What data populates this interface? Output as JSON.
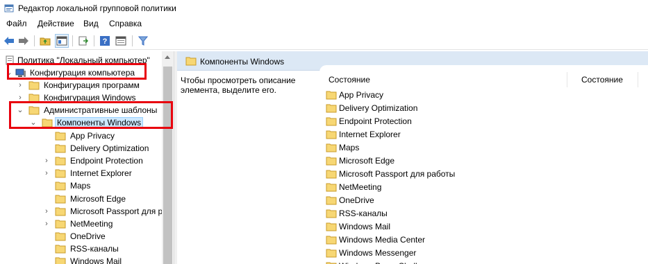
{
  "window": {
    "title": "Редактор локальной групповой политики"
  },
  "menu": [
    "Файл",
    "Действие",
    "Вид",
    "Справка"
  ],
  "toolbar": {
    "buttons": [
      "back-arrow-icon",
      "forward-arrow-icon",
      "up-folder-icon",
      "show-hide-tree-icon",
      "export-list-icon",
      "help-icon",
      "properties-icon",
      "filter-icon"
    ]
  },
  "tree": {
    "root": "Политика \"Локальный компьютер\"",
    "computer_config": "Конфигурация компьютера",
    "software_config": "Конфигурация программ",
    "windows_config": "Конфигурация Windows",
    "admin_templates": "Административные шаблоны",
    "windows_components": "Компоненты Windows",
    "children": [
      {
        "label": "App Privacy",
        "expandable": false
      },
      {
        "label": "Delivery Optimization",
        "expandable": false
      },
      {
        "label": "Endpoint Protection",
        "expandable": true
      },
      {
        "label": "Internet Explorer",
        "expandable": true
      },
      {
        "label": "Maps",
        "expandable": false
      },
      {
        "label": "Microsoft Edge",
        "expandable": false
      },
      {
        "label": "Microsoft Passport для р",
        "expandable": true
      },
      {
        "label": "NetMeeting",
        "expandable": true
      },
      {
        "label": "OneDrive",
        "expandable": false
      },
      {
        "label": "RSS-каналы",
        "expandable": false
      },
      {
        "label": "Windows Mail",
        "expandable": false
      }
    ]
  },
  "right": {
    "header": "Компоненты Windows",
    "description": "Чтобы просмотреть описание элемента, выделите его.",
    "columns": [
      "Состояние",
      "Состояние"
    ],
    "items": [
      "App Privacy",
      "Delivery Optimization",
      "Endpoint Protection",
      "Internet Explorer",
      "Maps",
      "Microsoft Edge",
      "Microsoft Passport для работы",
      "NetMeeting",
      "OneDrive",
      "RSS-каналы",
      "Windows Mail",
      "Windows Media Center",
      "Windows Messenger",
      "Windows PowerShell"
    ]
  },
  "colors": {
    "highlight_box": "#e8000d",
    "header_bg": "#dce8f5",
    "selection": "#cce8ff",
    "folder": "#f7d774"
  }
}
